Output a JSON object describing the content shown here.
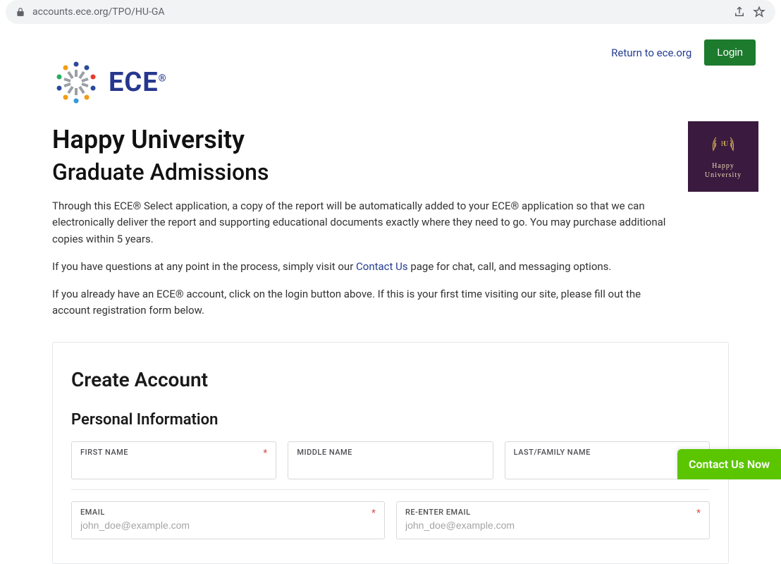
{
  "browser": {
    "url": "accounts.ece.org/TPO/HU-GA"
  },
  "top": {
    "return_link": "Return to ece.org",
    "login_label": "Login"
  },
  "logo": {
    "text": "ECE"
  },
  "badge": {
    "abbr": "HU",
    "name_line1": "Happy",
    "name_line2": "University"
  },
  "headings": {
    "university": "Happy University",
    "program": "Graduate Admissions"
  },
  "intro": {
    "p1": "Through this ECE® Select application, a copy of the report will be automatically added to your ECE® application so that we can electronically deliver the report and supporting educational documents exactly where they need to go. You may purchase additional copies within 5 years.",
    "p2_before": "If you have questions at any point in the process, simply visit our ",
    "p2_link": "Contact Us",
    "p2_after": " page for chat, call, and messaging options.",
    "p3": "If you already have an ECE® account, click on the login button above. If this is your first time visiting our site, please fill out the account registration form below."
  },
  "form": {
    "title": "Create Account",
    "section_personal": "Personal Information",
    "fields": {
      "first_name": {
        "label": "FIRST NAME",
        "required": "*"
      },
      "middle_name": {
        "label": "MIDDLE NAME"
      },
      "last_name": {
        "label": "LAST/FAMILY NAME",
        "required": "*"
      },
      "email": {
        "label": "EMAIL",
        "required": "*",
        "placeholder": "john_doe@example.com"
      },
      "reemail": {
        "label": "RE-ENTER EMAIL",
        "required": "*",
        "placeholder": "john_doe@example.com"
      }
    }
  },
  "widget": {
    "contact_label": "Contact Us Now"
  }
}
